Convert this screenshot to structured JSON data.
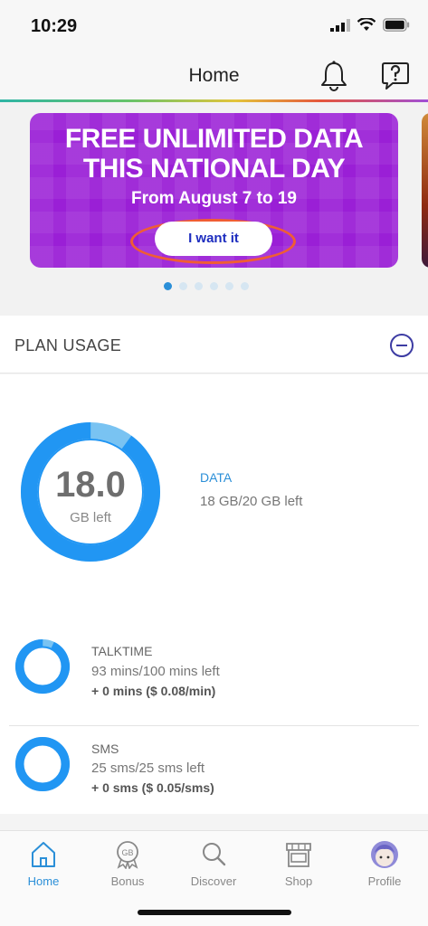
{
  "status": {
    "time": "10:29"
  },
  "nav": {
    "title": "Home",
    "icons": [
      "bell-icon",
      "help-icon"
    ]
  },
  "banner": {
    "title_line1": "FREE UNLIMITED DATA",
    "title_line2": "THIS NATIONAL DAY",
    "subtitle": "From August 7 to 19",
    "button": "I want it",
    "color": "#9a1fd6"
  },
  "carousel": {
    "page_count": 6,
    "active_index": 0
  },
  "plan_usage": {
    "title": "PLAN USAGE",
    "data": {
      "value": "18.0",
      "unit": "GB left",
      "label": "DATA",
      "left_text": "18 GB/20 GB left",
      "fraction_left": 0.9
    },
    "talktime": {
      "label": "TALKTIME",
      "left_text": "93 mins/100 mins left",
      "extra": "+ 0 mins ($ 0.08/min)",
      "fraction_left": 0.93
    },
    "sms": {
      "label": "SMS",
      "left_text": "25 sms/25 sms left",
      "extra": "+ 0 sms ($ 0.05/sms)",
      "fraction_left": 1.0
    }
  },
  "tabs": [
    {
      "label": "Home",
      "icon": "home-icon",
      "active": true
    },
    {
      "label": "Bonus",
      "icon": "gb-badge-icon",
      "active": false
    },
    {
      "label": "Discover",
      "icon": "search-icon",
      "active": false
    },
    {
      "label": "Shop",
      "icon": "shop-icon",
      "active": false
    },
    {
      "label": "Profile",
      "icon": "avatar-icon",
      "active": false
    }
  ],
  "colors": {
    "accent": "#2b8fd8",
    "ring_light": "#79c3f2",
    "ring_dark": "#2196f3"
  }
}
